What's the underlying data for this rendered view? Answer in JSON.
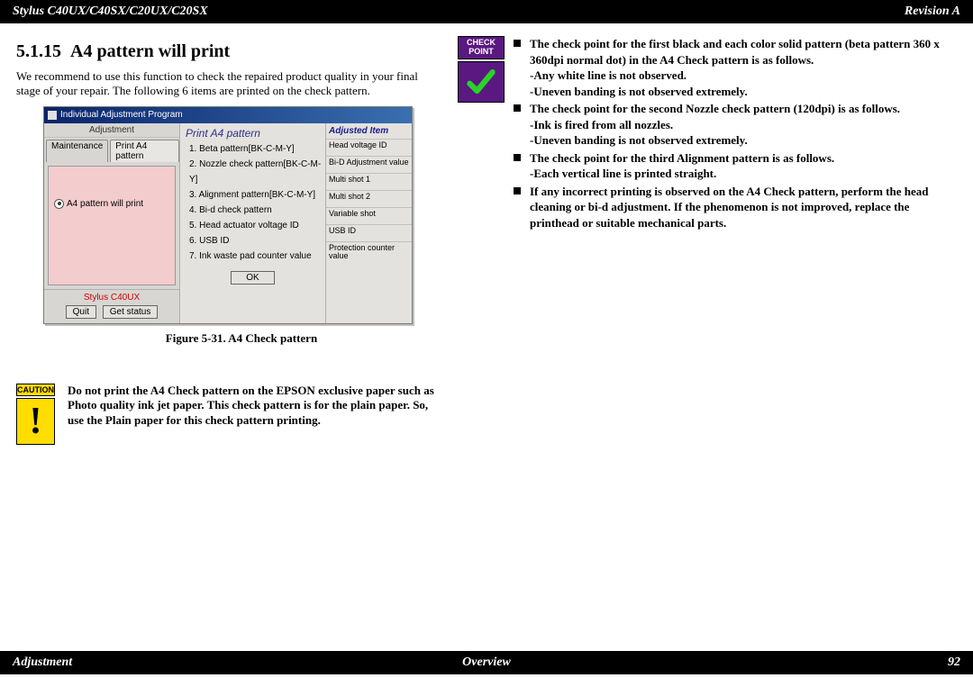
{
  "header": {
    "left": "Stylus C40UX/C40SX/C20UX/C20SX",
    "right": "Revision A"
  },
  "footer": {
    "left": "Adjustment",
    "center": "Overview",
    "right": "92"
  },
  "section": {
    "number": "5.1.15",
    "title": "A4 pattern will print"
  },
  "intro": "We recommend to use this function to check the repaired product quality in your final stage of your repair. The following 6 items are printed on the check pattern.",
  "figure_caption": "Figure 5-31.  A4 Check pattern",
  "app": {
    "window_title": "Individual Adjustment Program",
    "section_label": "Adjustment",
    "tabs": {
      "maintenance": "Maintenance",
      "print_a4": "Print A4 pattern"
    },
    "radio_label": "A4 pattern will print",
    "model": "Stylus C40UX",
    "quit": "Quit",
    "get_status": "Get status",
    "center_title": "Print A4 pattern",
    "list": {
      "1": "1. Beta pattern[BK-C-M-Y]",
      "2": "2. Nozzle check pattern[BK-C-M-Y]",
      "3": "3. Alignment pattern[BK-C-M-Y]",
      "4": "4. Bi-d check pattern",
      "5": "5. Head actuator voltage ID",
      "6": "6. USB ID",
      "7": "7. Ink waste pad counter value"
    },
    "ok": "OK",
    "right_title": "Adjusted Item",
    "right_items": {
      "0": "Head voltage ID",
      "1": "Bi-D Adjustment value",
      "2": "Multi shot 1",
      "3": "Multi shot 2",
      "4": "Variable shot",
      "5": "USB ID",
      "6": "Protection counter value"
    }
  },
  "caution": {
    "label": "CAUTION",
    "bang": "!",
    "text": "Do not print the A4 Check pattern on the EPSON exclusive paper such as Photo quality ink jet paper. This check pattern is for the plain paper. So, use the Plain paper for this check pattern printing."
  },
  "checkpoint": {
    "label_line1": "CHECK",
    "label_line2": "POINT"
  },
  "bullets": {
    "0": "The check point for the first black and each color solid pattern (beta pattern 360 x 360dpi normal dot) in the A4 Check pattern is as follows.\n-Any white line is not observed.\n-Uneven banding is not observed extremely.",
    "1": "The check point for the second Nozzle check pattern (120dpi) is as follows.\n-Ink is fired from all nozzles.\n-Uneven banding is not observed extremely.",
    "2": "The check point for the third Alignment pattern is as follows.\n-Each vertical line is printed straight.",
    "3": "If any incorrect printing is observed on the A4 Check pattern, perform the head cleaning or bi-d adjustment. If the phenomenon is not improved, replace the printhead or suitable mechanical parts."
  }
}
